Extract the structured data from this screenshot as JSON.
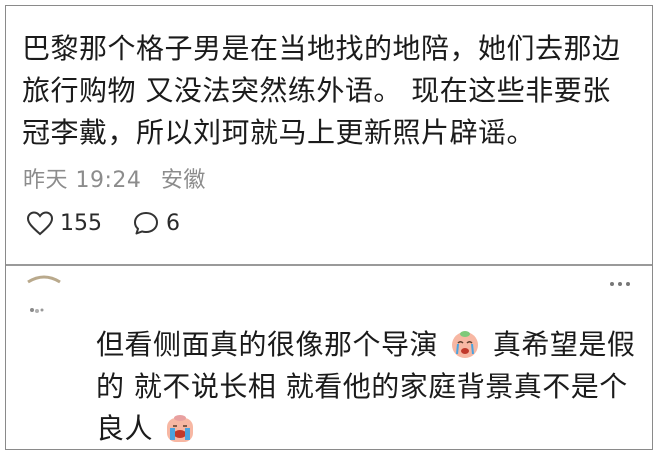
{
  "comment": {
    "text": "巴黎那个格子男是在当地找的地陪，她们去那边旅行购物 又没法突然练外语。 现在这些非要张冠李戴，所以刘珂就马上更新照片辟谣。",
    "time": "昨天 19:24",
    "location": "安徽",
    "likes": "155",
    "replies": "6"
  },
  "reply": {
    "text_part1": "但看侧面真的很像那个导演",
    "text_part2": " 真希望是假的 就不说长相 就看他的家庭背景真不是个良人",
    "emoji1": "crying-face-emoji",
    "emoji2": "wailing-face-emoji"
  },
  "icons": {
    "like": "heart-icon",
    "comment": "speech-bubble-icon",
    "more": "more-dots-icon"
  },
  "colors": {
    "text": "#1b1b1b",
    "meta": "#8c8c8c",
    "border": "#8a8a8a"
  }
}
